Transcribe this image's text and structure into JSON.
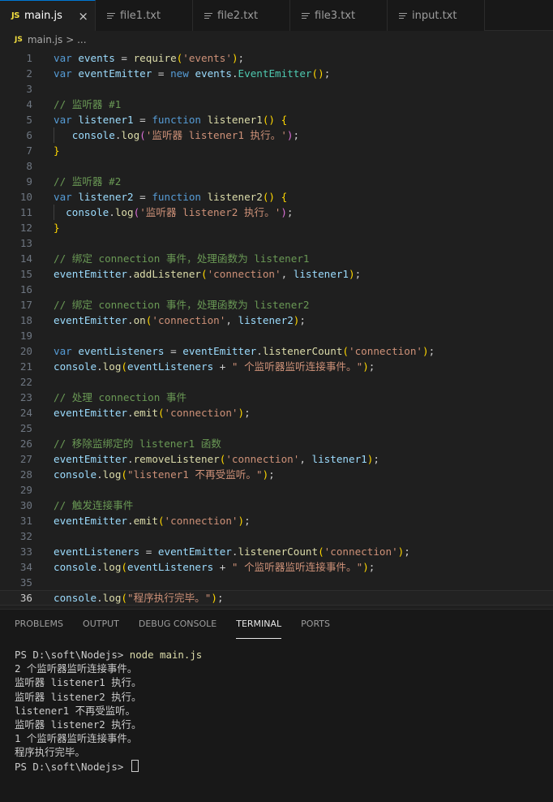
{
  "tabs": [
    {
      "label": "main.js",
      "kind": "js",
      "active": true
    },
    {
      "label": "file1.txt",
      "kind": "txt"
    },
    {
      "label": "file2.txt",
      "kind": "txt"
    },
    {
      "label": "file3.txt",
      "kind": "txt"
    },
    {
      "label": "input.txt",
      "kind": "txt"
    }
  ],
  "tab_close": "×",
  "breadcrumb": {
    "file": "main.js",
    "sep": "> ..."
  },
  "editor": {
    "current_line": 36,
    "lines": [
      [
        [
          "k",
          "var "
        ],
        [
          "v",
          "events"
        ],
        [
          "p",
          " = "
        ],
        [
          "f",
          "require"
        ],
        [
          "b1",
          "("
        ],
        [
          "s",
          "'events'"
        ],
        [
          "b1",
          ")"
        ],
        [
          "p",
          ";"
        ]
      ],
      [
        [
          "k",
          "var "
        ],
        [
          "v",
          "eventEmitter"
        ],
        [
          "p",
          " = "
        ],
        [
          "k",
          "new "
        ],
        [
          "v",
          "events"
        ],
        [
          "p",
          "."
        ],
        [
          "t",
          "EventEmitter"
        ],
        [
          "b1",
          "()"
        ],
        [
          "p",
          ";"
        ]
      ],
      [],
      [
        [
          "c",
          "// 监听器 #1"
        ]
      ],
      [
        [
          "k",
          "var "
        ],
        [
          "v",
          "listener1"
        ],
        [
          "p",
          " = "
        ],
        [
          "k",
          "function "
        ],
        [
          "f",
          "listener1"
        ],
        [
          "b1",
          "() {"
        ]
      ],
      [
        [
          "p",
          "   "
        ],
        [
          "v",
          "console"
        ],
        [
          "p",
          "."
        ],
        [
          "f",
          "log"
        ],
        [
          "b2",
          "("
        ],
        [
          "s",
          "'监听器 listener1 执行。'"
        ],
        [
          "b2",
          ")"
        ],
        [
          "p",
          ";"
        ]
      ],
      [
        [
          "b1",
          "}"
        ]
      ],
      [],
      [
        [
          "c",
          "// 监听器 #2"
        ]
      ],
      [
        [
          "k",
          "var "
        ],
        [
          "v",
          "listener2"
        ],
        [
          "p",
          " = "
        ],
        [
          "k",
          "function "
        ],
        [
          "f",
          "listener2"
        ],
        [
          "b1",
          "() {"
        ]
      ],
      [
        [
          "p",
          "  "
        ],
        [
          "v",
          "console"
        ],
        [
          "p",
          "."
        ],
        [
          "f",
          "log"
        ],
        [
          "b2",
          "("
        ],
        [
          "s",
          "'监听器 listener2 执行。'"
        ],
        [
          "b2",
          ")"
        ],
        [
          "p",
          ";"
        ]
      ],
      [
        [
          "b1",
          "}"
        ]
      ],
      [],
      [
        [
          "c",
          "// 绑定 connection 事件，处理函数为 listener1"
        ]
      ],
      [
        [
          "v",
          "eventEmitter"
        ],
        [
          "p",
          "."
        ],
        [
          "f",
          "addListener"
        ],
        [
          "b1",
          "("
        ],
        [
          "s",
          "'connection'"
        ],
        [
          "p",
          ", "
        ],
        [
          "v",
          "listener1"
        ],
        [
          "b1",
          ")"
        ],
        [
          "p",
          ";"
        ]
      ],
      [],
      [
        [
          "c",
          "// 绑定 connection 事件，处理函数为 listener2"
        ]
      ],
      [
        [
          "v",
          "eventEmitter"
        ],
        [
          "p",
          "."
        ],
        [
          "f",
          "on"
        ],
        [
          "b1",
          "("
        ],
        [
          "s",
          "'connection'"
        ],
        [
          "p",
          ", "
        ],
        [
          "v",
          "listener2"
        ],
        [
          "b1",
          ")"
        ],
        [
          "p",
          ";"
        ]
      ],
      [],
      [
        [
          "k",
          "var "
        ],
        [
          "v",
          "eventListeners"
        ],
        [
          "p",
          " = "
        ],
        [
          "v",
          "eventEmitter"
        ],
        [
          "p",
          "."
        ],
        [
          "f",
          "listenerCount"
        ],
        [
          "b1",
          "("
        ],
        [
          "s",
          "'connection'"
        ],
        [
          "b1",
          ")"
        ],
        [
          "p",
          ";"
        ]
      ],
      [
        [
          "v",
          "console"
        ],
        [
          "p",
          "."
        ],
        [
          "f",
          "log"
        ],
        [
          "b1",
          "("
        ],
        [
          "v",
          "eventListeners"
        ],
        [
          "p",
          " + "
        ],
        [
          "s",
          "\" 个监听器监听连接事件。\""
        ],
        [
          "b1",
          ")"
        ],
        [
          "p",
          ";"
        ]
      ],
      [],
      [
        [
          "c",
          "// 处理 connection 事件"
        ]
      ],
      [
        [
          "v",
          "eventEmitter"
        ],
        [
          "p",
          "."
        ],
        [
          "f",
          "emit"
        ],
        [
          "b1",
          "("
        ],
        [
          "s",
          "'connection'"
        ],
        [
          "b1",
          ")"
        ],
        [
          "p",
          ";"
        ]
      ],
      [],
      [
        [
          "c",
          "// 移除监绑定的 listener1 函数"
        ]
      ],
      [
        [
          "v",
          "eventEmitter"
        ],
        [
          "p",
          "."
        ],
        [
          "f",
          "removeListener"
        ],
        [
          "b1",
          "("
        ],
        [
          "s",
          "'connection'"
        ],
        [
          "p",
          ", "
        ],
        [
          "v",
          "listener1"
        ],
        [
          "b1",
          ")"
        ],
        [
          "p",
          ";"
        ]
      ],
      [
        [
          "v",
          "console"
        ],
        [
          "p",
          "."
        ],
        [
          "f",
          "log"
        ],
        [
          "b1",
          "("
        ],
        [
          "s",
          "\"listener1 不再受监听。\""
        ],
        [
          "b1",
          ")"
        ],
        [
          "p",
          ";"
        ]
      ],
      [],
      [
        [
          "c",
          "// 触发连接事件"
        ]
      ],
      [
        [
          "v",
          "eventEmitter"
        ],
        [
          "p",
          "."
        ],
        [
          "f",
          "emit"
        ],
        [
          "b1",
          "("
        ],
        [
          "s",
          "'connection'"
        ],
        [
          "b1",
          ")"
        ],
        [
          "p",
          ";"
        ]
      ],
      [],
      [
        [
          "v",
          "eventListeners"
        ],
        [
          "p",
          " = "
        ],
        [
          "v",
          "eventEmitter"
        ],
        [
          "p",
          "."
        ],
        [
          "f",
          "listenerCount"
        ],
        [
          "b1",
          "("
        ],
        [
          "s",
          "'connection'"
        ],
        [
          "b1",
          ")"
        ],
        [
          "p",
          ";"
        ]
      ],
      [
        [
          "v",
          "console"
        ],
        [
          "p",
          "."
        ],
        [
          "f",
          "log"
        ],
        [
          "b1",
          "("
        ],
        [
          "v",
          "eventListeners"
        ],
        [
          "p",
          " + "
        ],
        [
          "s",
          "\" 个监听器监听连接事件。\""
        ],
        [
          "b1",
          ")"
        ],
        [
          "p",
          ";"
        ]
      ],
      [],
      [
        [
          "v",
          "console"
        ],
        [
          "p",
          "."
        ],
        [
          "f",
          "log"
        ],
        [
          "b1",
          "("
        ],
        [
          "s",
          "\"程序执行完毕。\""
        ],
        [
          "b1",
          ")"
        ],
        [
          "p",
          ";"
        ]
      ]
    ]
  },
  "panel": {
    "tabs": [
      "PROBLEMS",
      "OUTPUT",
      "DEBUG CONSOLE",
      "TERMINAL",
      "PORTS"
    ],
    "active_tab": "TERMINAL",
    "terminal": {
      "prompt": "PS D:\\soft\\Nodejs> ",
      "command": "node main.js",
      "output": [
        "2 个监听器监听连接事件。",
        "监听器 listener1 执行。",
        "监听器 listener2 执行。",
        "listener1 不再受监听。",
        "监听器 listener2 执行。",
        "1 个监听器监听连接事件。",
        "程序执行完毕。"
      ],
      "final_prompt": "PS D:\\soft\\Nodejs> "
    }
  }
}
